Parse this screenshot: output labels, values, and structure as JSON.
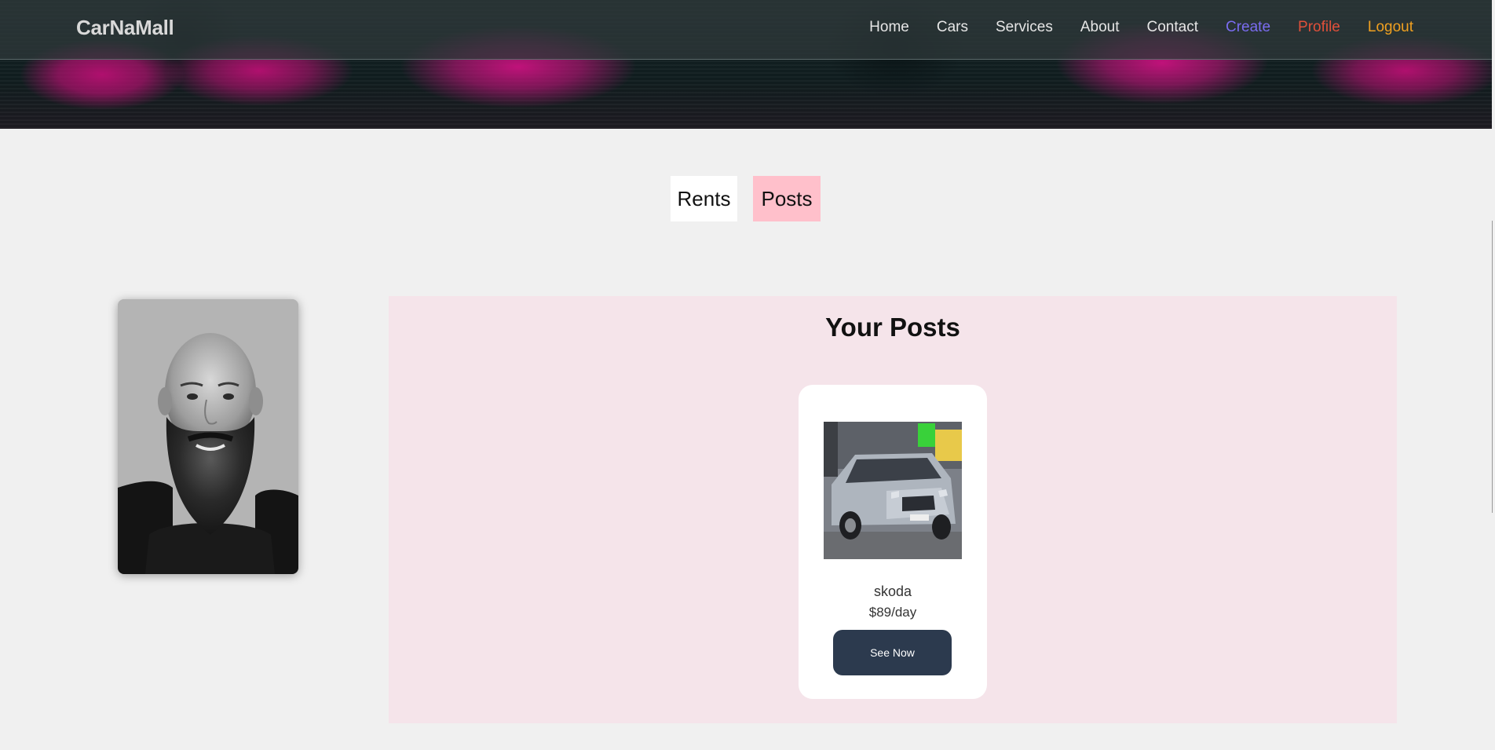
{
  "brand": "CarNaMall",
  "nav": {
    "home": "Home",
    "cars": "Cars",
    "services": "Services",
    "about": "About",
    "contact": "Contact",
    "create": "Create",
    "profile": "Profile",
    "logout": "Logout"
  },
  "tabs": {
    "rents": "Rents",
    "posts": "Posts",
    "active": "Posts"
  },
  "posts": {
    "title": "Your Posts",
    "items": [
      {
        "name": "skoda",
        "price": "$89/day",
        "button": "See Now",
        "image": "silver-skoda-car-photo"
      }
    ]
  },
  "profile": {
    "image": "bald-bearded-man-portrait"
  },
  "colors": {
    "nav_create": "#7a6cf0",
    "nav_profile": "#e0503a",
    "nav_logout": "#f0a020",
    "tab_posts_bg": "#ffc0cb",
    "panel_bg": "#f5e4ea",
    "button_bg": "#2c3a4e"
  }
}
